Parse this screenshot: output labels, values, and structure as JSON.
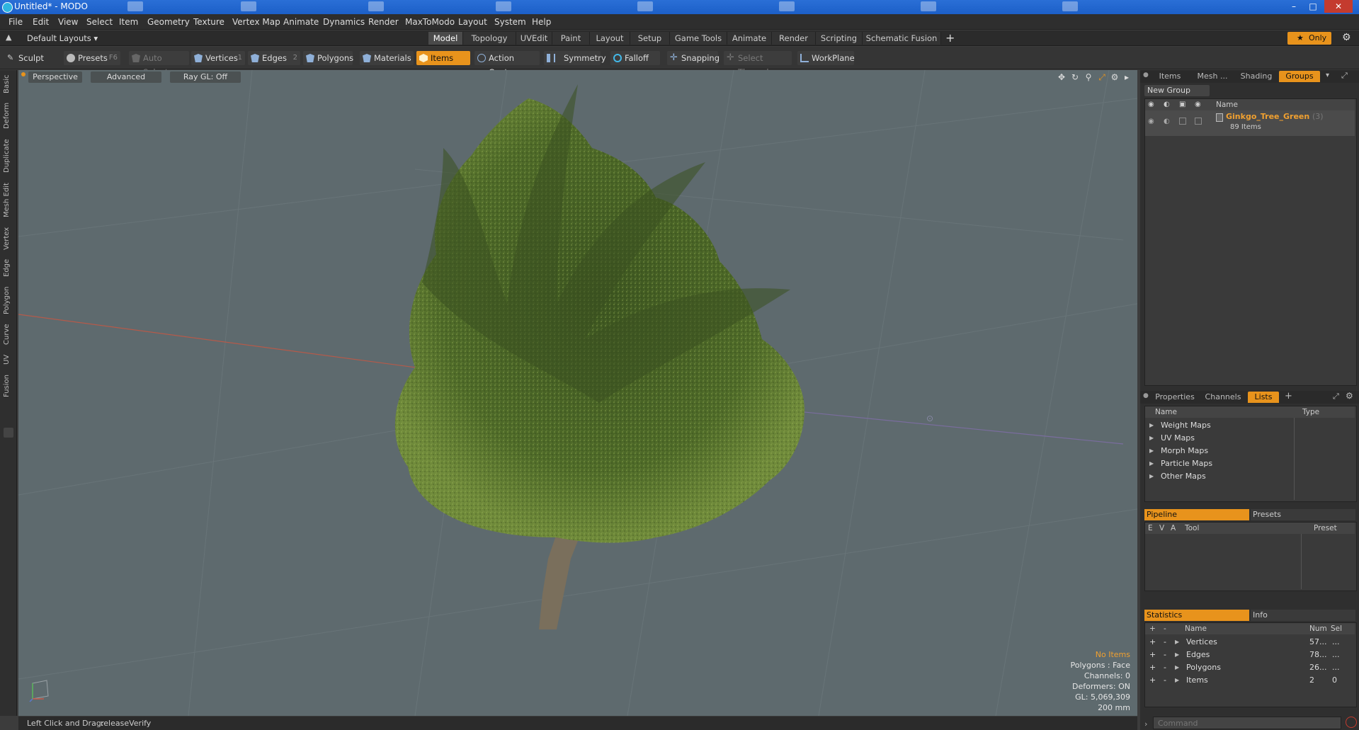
{
  "window": {
    "title": "Untitled* - MODO"
  },
  "menu": [
    "File",
    "Edit",
    "View",
    "Select",
    "Item",
    "Geometry",
    "Texture",
    "Vertex Map",
    "Animate",
    "Dynamics",
    "Render",
    "MaxToModo",
    "Layout",
    "System",
    "Help"
  ],
  "layout_selector": "Default Layouts",
  "tabs": [
    "Model",
    "Topology",
    "UVEdit",
    "Paint",
    "Layout",
    "Setup",
    "Game Tools",
    "Animate",
    "Render",
    "Scripting",
    "Schematic Fusion"
  ],
  "tab_add": "+",
  "only_label": "Only",
  "toolbar": {
    "sculpt": "Sculpt",
    "presets": "Presets",
    "presets_key": "F6",
    "auto_select": "Auto Select",
    "vertices": "Vertices",
    "vertices_key": "1",
    "edges": "Edges",
    "edges_key": "2",
    "polygons": "Polygons",
    "materials": "Materials",
    "items": "Items",
    "action_center": "Action Center",
    "symmetry": "Symmetry",
    "falloff": "Falloff",
    "snapping": "Snapping",
    "select_through": "Select Through",
    "workplane": "WorkPlane"
  },
  "left_tabs": [
    "Basic",
    "Deform",
    "Duplicate",
    "Mesh Edit",
    "Vertex",
    "Edge",
    "Polygon",
    "Curve",
    "UV",
    "Fusion"
  ],
  "viewport": {
    "perspective": "Perspective",
    "advanced": "Advanced",
    "raygl": "Ray GL: Off",
    "stats": {
      "no_items": "No Items",
      "polygons": "Polygons : Face",
      "channels": "Channels: 0",
      "deformers": "Deformers: ON",
      "gl": "GL: 5,069,309",
      "scale": "200 mm"
    }
  },
  "statusbar": {
    "hint": "Left Click and Drag:",
    "action": "releaseVerify"
  },
  "groups_panel": {
    "tabs": [
      "Items",
      "Mesh ...",
      "Shading",
      "Groups"
    ],
    "new_group": "New Group",
    "name_header": "Name",
    "group_name": "Ginkgo_Tree_Green",
    "group_count": "(3)",
    "group_items": "89 Items"
  },
  "lists_panel": {
    "tabs": [
      "Properties",
      "Channels",
      "Lists"
    ],
    "add": "+",
    "headers": {
      "name": "Name",
      "type": "Type"
    },
    "rows": [
      "Weight Maps",
      "UV Maps",
      "Morph Maps",
      "Particle Maps",
      "Other Maps"
    ]
  },
  "pipeline_panel": {
    "tabs": [
      "Pipeline",
      "Presets"
    ],
    "headers": {
      "e": "E",
      "v": "V",
      "a": "A",
      "tool": "Tool",
      "preset": "Preset"
    }
  },
  "statistics_panel": {
    "tabs": [
      "Statistics",
      "Info"
    ],
    "headers": {
      "plus": "+",
      "minus": "-",
      "name": "Name",
      "num": "Num",
      "sel": "Sel"
    },
    "rows": [
      {
        "name": "Vertices",
        "num": "57...",
        "sel": "..."
      },
      {
        "name": "Edges",
        "num": "78...",
        "sel": "..."
      },
      {
        "name": "Polygons",
        "num": "26...",
        "sel": "..."
      },
      {
        "name": "Items",
        "num": "2",
        "sel": "0"
      }
    ]
  },
  "command": {
    "placeholder": "Command"
  },
  "colors": {
    "accent": "#e8931c",
    "viewport": "#5e6a6e",
    "foliage": "#4f6a2a"
  }
}
